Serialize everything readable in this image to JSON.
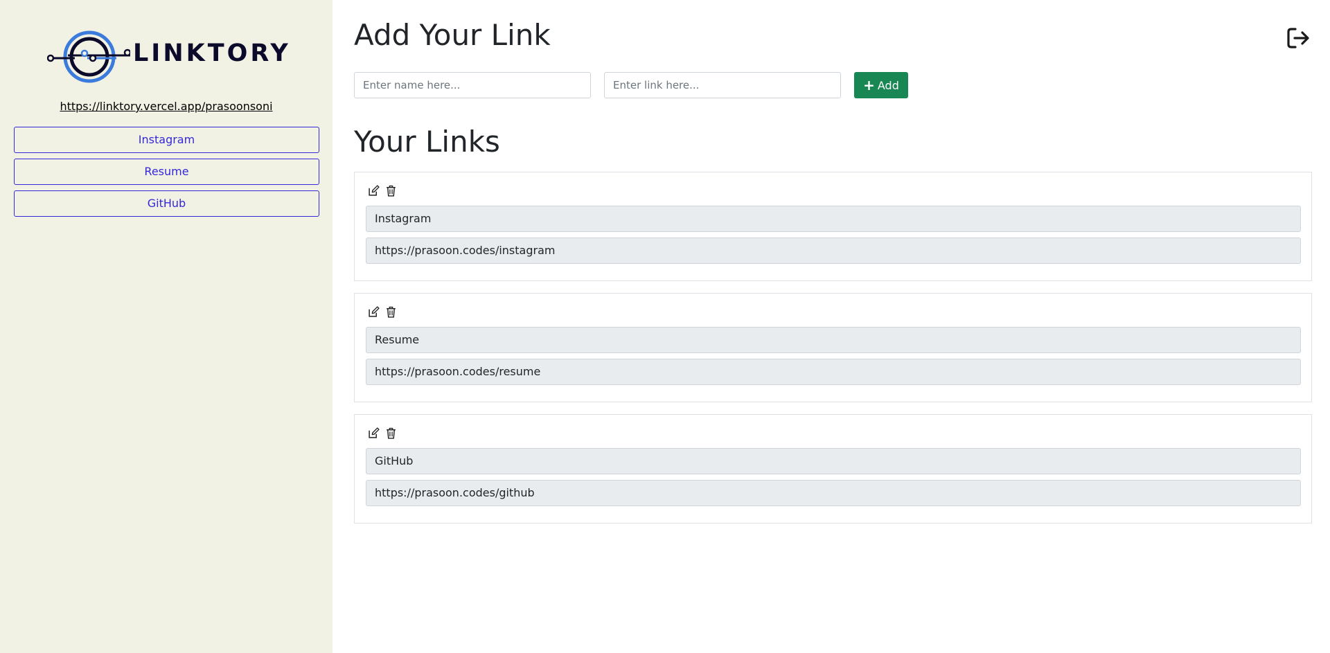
{
  "sidebar": {
    "logo_text": "LINKTORY",
    "profile_url": "https://linktory.vercel.app/prasoonsoni",
    "links": [
      {
        "label": "Instagram"
      },
      {
        "label": "Resume"
      },
      {
        "label": "GitHub"
      }
    ],
    "accent_color": "#3427d9",
    "background_color": "#f2f2e4"
  },
  "main": {
    "add_title": "Add Your Link",
    "name_placeholder": "Enter name here...",
    "link_placeholder": "Enter link here...",
    "add_button_label": "Add",
    "links_title": "Your Links",
    "logout_icon": "sign-out-icon",
    "cards": [
      {
        "name": "Instagram",
        "url": "https://prasoon.codes/instagram"
      },
      {
        "name": "Resume",
        "url": "https://prasoon.codes/resume"
      },
      {
        "name": "GitHub",
        "url": "https://prasoon.codes/github"
      }
    ]
  },
  "colors": {
    "add_button": "#198754",
    "field_bg": "#e9ecef"
  }
}
